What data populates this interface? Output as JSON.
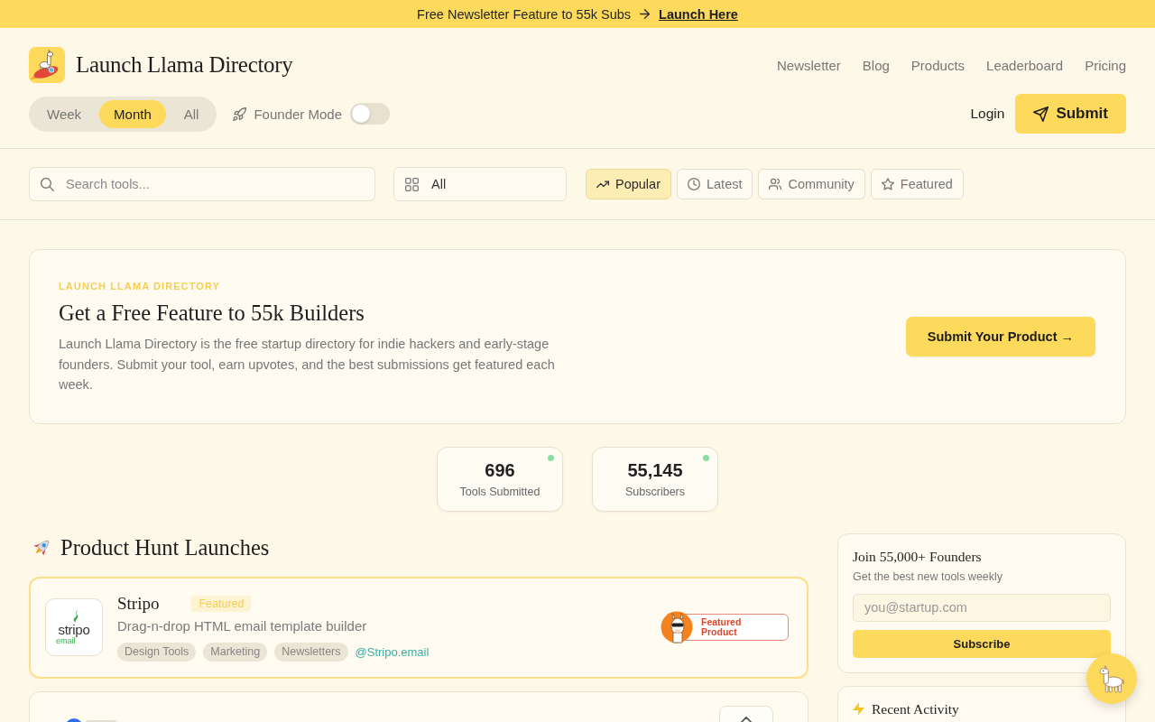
{
  "announcement": {
    "text": "Free Newsletter Feature to 55k Subs",
    "link": "Launch Here"
  },
  "header": {
    "title": "Launch Llama Directory",
    "nav": [
      "Newsletter",
      "Blog",
      "Products",
      "Leaderboard",
      "Pricing"
    ],
    "periods": [
      {
        "label": "Week",
        "selected": false
      },
      {
        "label": "Month",
        "selected": true
      },
      {
        "label": "All",
        "selected": false
      }
    ],
    "founder_mode": {
      "label": "Founder Mode",
      "on": false
    },
    "login": "Login",
    "submit": "Submit"
  },
  "filters": {
    "search": {
      "placeholder": "Search tools..."
    },
    "category": {
      "value": "All"
    },
    "sorts": [
      {
        "label": "Popular",
        "selected": true
      },
      {
        "label": "Latest",
        "selected": false
      },
      {
        "label": "Community",
        "selected": false
      },
      {
        "label": "Featured",
        "selected": false
      }
    ]
  },
  "hero": {
    "eyebrow": "LAUNCH LLAMA DIRECTORY",
    "title": "Get a Free Feature to 55k Builders",
    "body": "Launch Llama Directory is the free startup directory for indie hackers and early-stage founders. Submit your tool, earn upvotes, and the best submissions get featured each week.",
    "button": "Submit Your Product →"
  },
  "stats": [
    {
      "value": "696",
      "label": "Tools Submitted",
      "live": true
    },
    {
      "value": "55,145",
      "label": "Subscribers",
      "live": true
    }
  ],
  "launches": {
    "title": "Product Hunt Launches",
    "items": [
      {
        "name": "Stripo",
        "featured": true,
        "badge": "Featured",
        "logo_text": "stripo",
        "logo_subtext": "email",
        "description": "Drag-n-drop HTML email template builder",
        "tags": [
          "Design Tools",
          "Marketing",
          "Newsletters"
        ],
        "handle": "@Stripo.email",
        "award": "Featured Product"
      },
      {
        "featured": false
      }
    ]
  },
  "newsletter": {
    "title": "Join 55,000+ Founders",
    "subtitle": "Get the best new tools weekly",
    "email": {
      "placeholder": "you@startup.com"
    },
    "button": "Subscribe"
  },
  "activity": {
    "title": "Recent Activity"
  }
}
